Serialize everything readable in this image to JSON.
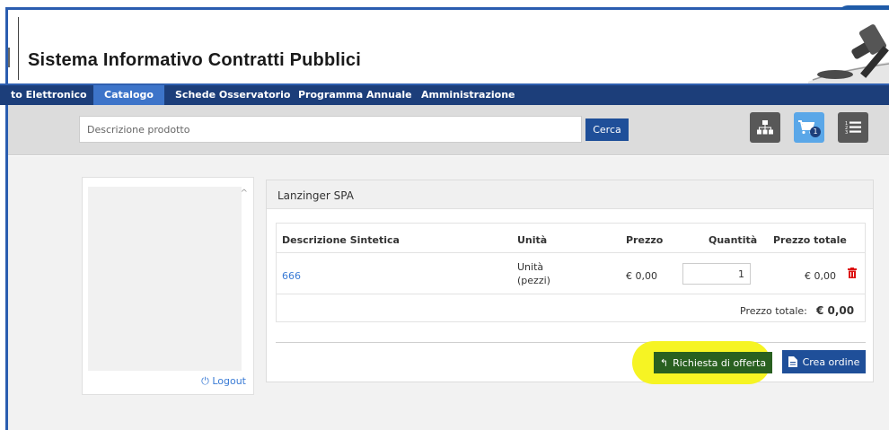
{
  "header": {
    "title": "Sistema Informativo Contratti Pubblici"
  },
  "navbar": {
    "items": [
      {
        "label": "to Elettronico"
      },
      {
        "label": "Catalogo"
      },
      {
        "label": "Schede Osservatorio"
      },
      {
        "label": "Programma Annuale"
      },
      {
        "label": "Amministrazione"
      }
    ],
    "active": "Catalogo"
  },
  "search": {
    "placeholder": "Descrizione prodotto",
    "button_label": "Cerca"
  },
  "toolbar": {
    "cart_badge": "1",
    "icons": [
      "sitemap-icon",
      "shopping-cart-icon",
      "ordered-list-icon"
    ]
  },
  "sidebar": {
    "logout_label": "Logout"
  },
  "cart": {
    "supplier": "Lanzinger SPA",
    "columns": [
      "Descrizione Sintetica",
      "Unità",
      "Prezzo",
      "Quantità",
      "Prezzo totale"
    ],
    "rows": [
      {
        "description": "666",
        "unit_line1": "Unità",
        "unit_line2": "(pezzi)",
        "price": "€ 0,00",
        "quantity": "1",
        "total": "€ 0,00"
      }
    ],
    "total_label": "Prezzo totale:",
    "total_value": "€ 0,00",
    "request_offer_label": "Richiesta di offerta",
    "create_order_label": "Crea ordine"
  },
  "colors": {
    "navbar": "#1c3e7a",
    "nav_active": "#3d74c9",
    "primary_button": "#1f4f99",
    "offer_button": "#296020",
    "highlight": "#f6f423",
    "link": "#3a7bd5"
  }
}
